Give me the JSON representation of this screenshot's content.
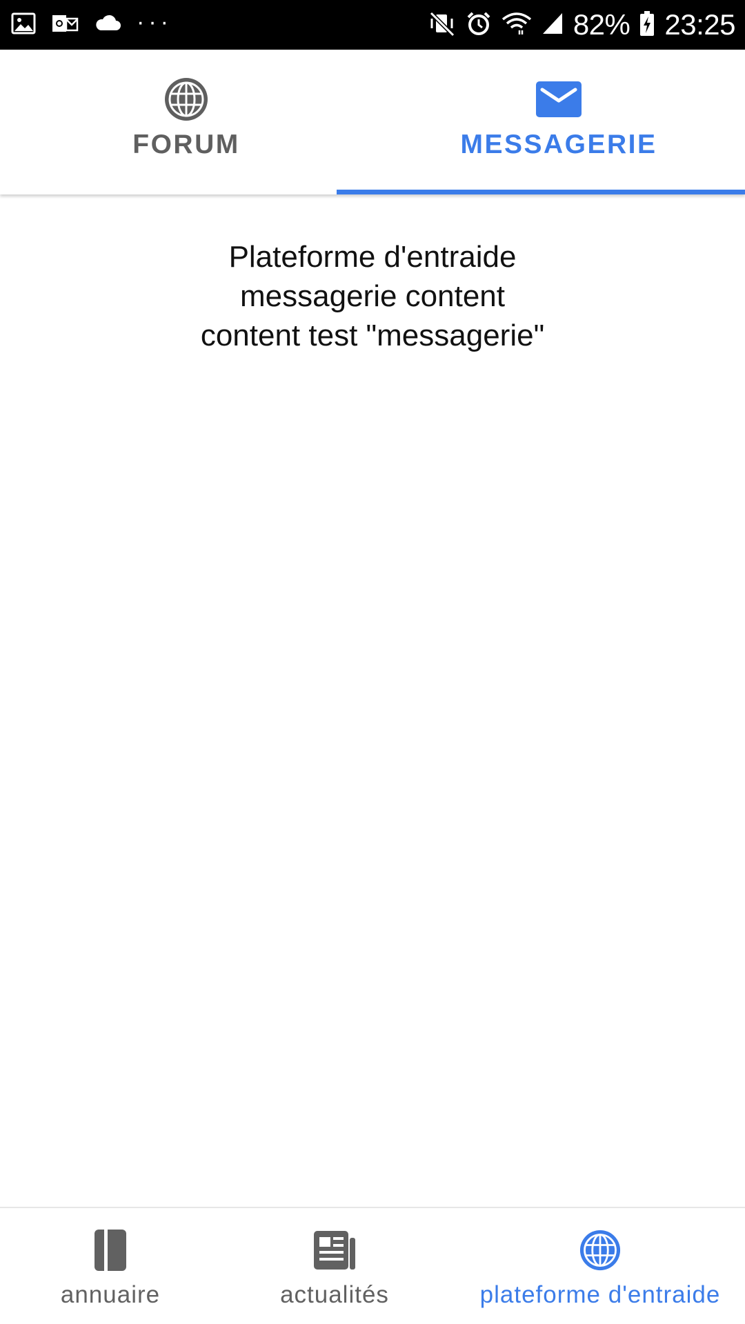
{
  "colors": {
    "accent": "#3b7ce9",
    "inactive": "#5f5f5f",
    "status_bar": "#000000"
  },
  "status_bar": {
    "left_icons": [
      "gallery-icon",
      "outlook-icon",
      "cloud-icon"
    ],
    "more": "···",
    "right_icons": [
      "vibrate-mute-icon",
      "alarm-icon",
      "wifi-icon",
      "signal-icon",
      "battery-charging-icon"
    ],
    "battery": "82%",
    "time": "23:25"
  },
  "top_tabs": [
    {
      "label": "FORUM",
      "icon": "globe-icon",
      "active": false
    },
    {
      "label": "MESSAGERIE",
      "icon": "envelope-icon",
      "active": true
    }
  ],
  "content": {
    "line1": "Plateforme d'entraide",
    "line2": "messagerie content",
    "line3": "content test \"messagerie\""
  },
  "bottom_nav": [
    {
      "label": "annuaire",
      "icon": "book-icon",
      "active": false
    },
    {
      "label": "actualités",
      "icon": "newspaper-icon",
      "active": false
    },
    {
      "label": "plateforme d'entraide",
      "icon": "globe-icon",
      "active": true
    }
  ]
}
